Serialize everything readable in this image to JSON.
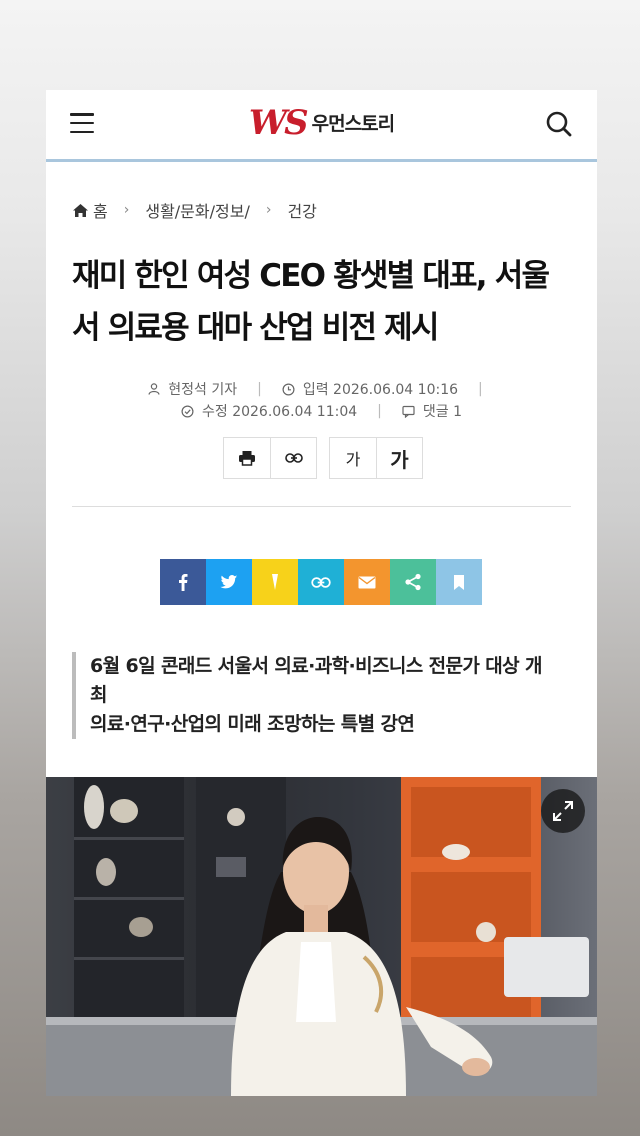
{
  "header": {
    "logo_mark": "WS",
    "logo_text": "우먼스토리"
  },
  "breadcrumb": {
    "home": "홈",
    "section": "생활/문화/정보/",
    "category": "건강"
  },
  "article": {
    "title_line1": "재미 한인 여성 CEO 황샛별 대표, 서울",
    "title_line2": "서 의료용 대마 산업 비전 제시",
    "author": "현정석 기자",
    "published": "입력 2026.06.04 10:16",
    "modified": "수정 2026.06.04 11:04",
    "comments": "댓글 1",
    "subtitle_line1": "6월 6일 콘래드 서울서 의료·과학·비즈니스 전문가 대상 개",
    "subtitle_line2": "최",
    "subtitle_line3": "의료·연구·산업의 미래 조망하는 특별 강연"
  },
  "tools": {
    "font_small": "가",
    "font_large": "가"
  },
  "share_colors": {
    "facebook": "#3b5998",
    "twitter": "#1da1f2",
    "kakao": "#f7d21a",
    "link": "#1fb0d6",
    "email": "#f3952e",
    "share": "#4cc09a",
    "bookmark": "#8ec5e6"
  },
  "icons": [
    "menu-icon",
    "search-icon",
    "home-icon",
    "user-icon",
    "clock-icon",
    "check-icon",
    "comment-icon",
    "print-icon",
    "link-icon",
    "facebook-icon",
    "twitter-icon",
    "kakao-icon",
    "email-icon",
    "share-icon",
    "bookmark-icon",
    "expand-icon"
  ]
}
